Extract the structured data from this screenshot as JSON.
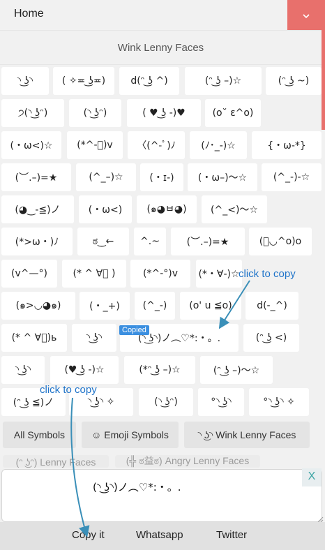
{
  "header": {
    "title": "Home",
    "dropdown_icon": "chevron-down-icon"
  },
  "section_title": "Wink Lenny Faces",
  "faces": [
    [
      "◝ ͜ʖ◝",
      "( ✧≖ ͜ʖ≖)",
      "d(ᵔ ͜ʖ ^)",
      "(ᵔ ͜ʖ –)☆",
      "(ᵔ ͜ʖ ~)"
    ],
    [
      "੭(◝ ͜ʖᵔ)",
      "(◝ ͜ʖᵔ)",
      "( ♥ ͜ʖ -)♥",
      "(o˘ ε^o)"
    ],
    [
      "(・ω<)☆",
      "(*^-ﾟ)v",
      "〈(^-ﾟ)ﾉ",
      "(ﾉ･_-)☆",
      "{・ω-*}"
    ],
    [
      "(︶.–)=★",
      "(^_–)☆",
      "(・ɪ-)",
      "(・ω–)〜☆",
      "(^_-)-☆"
    ],
    [
      "(◕‿-≦)ノ",
      "(・ω<)",
      "(๑◕ㅂ◕)",
      "(^_<)〜☆"
    ],
    [
      "(*>ω・)ﾉ",
      "ಠ‿←",
      "^.~",
      "(︶.–)=★",
      "(ﾟ◡^o)o"
    ],
    [
      "(v^—°)",
      "(* ^ ∀ﾟ )",
      "(*^-°)v",
      "(*・∀-)☆"
    ],
    [
      "(๑>◡◕๑)",
      "(・_+)",
      "(^_-)",
      "(o' u ≦o)",
      "d(-_^)"
    ],
    [
      "(* ^ ∀ﾟ)ь",
      "◝ ͜ʖ◝",
      "(◝ ͜ʖ◝)ノ︵♡*:・。.",
      "(ᵔ ͜ʖ <)"
    ],
    [
      "◝ ͜ʖ◝",
      "(♥ ͜ʖ -)☆",
      "(*ᵔ ͜ʖ –)☆",
      "(ᵔ ͜ʖ –)〜☆"
    ],
    [
      "(ᵔ ͜ʖ ≦)ノ",
      "◝ ͜ʖ◝ ✧",
      "(◝ ͜ʖᵔ)",
      "°◝ ͜ʖ◝",
      "°◝ ͜ʖ◝ ✧"
    ]
  ],
  "copied_badge": "Copied",
  "hint_top": "click to copy",
  "hint_bottom": "click to copy",
  "categories": [
    "All Symbols",
    "☺ Emoji Symbols",
    "◝ ͜ʖ◝ Wink Lenny Faces"
  ],
  "categories_faded": [
    "(ᵔ ͜ʖᵔ) Lenny Faces",
    "(╬ ಠ益ಠ) Angry Lenny Faces"
  ],
  "output_text": "(◝ ͜ʖ◝)ノ︵♡*:・。.",
  "close_label": "X",
  "actions": {
    "copy": "Copy it",
    "whatsapp": "Whatsapp",
    "twitter": "Twitter"
  },
  "colors": {
    "accent": "#e8706c",
    "link": "#1e73c9",
    "badge": "#3b8fe0"
  }
}
